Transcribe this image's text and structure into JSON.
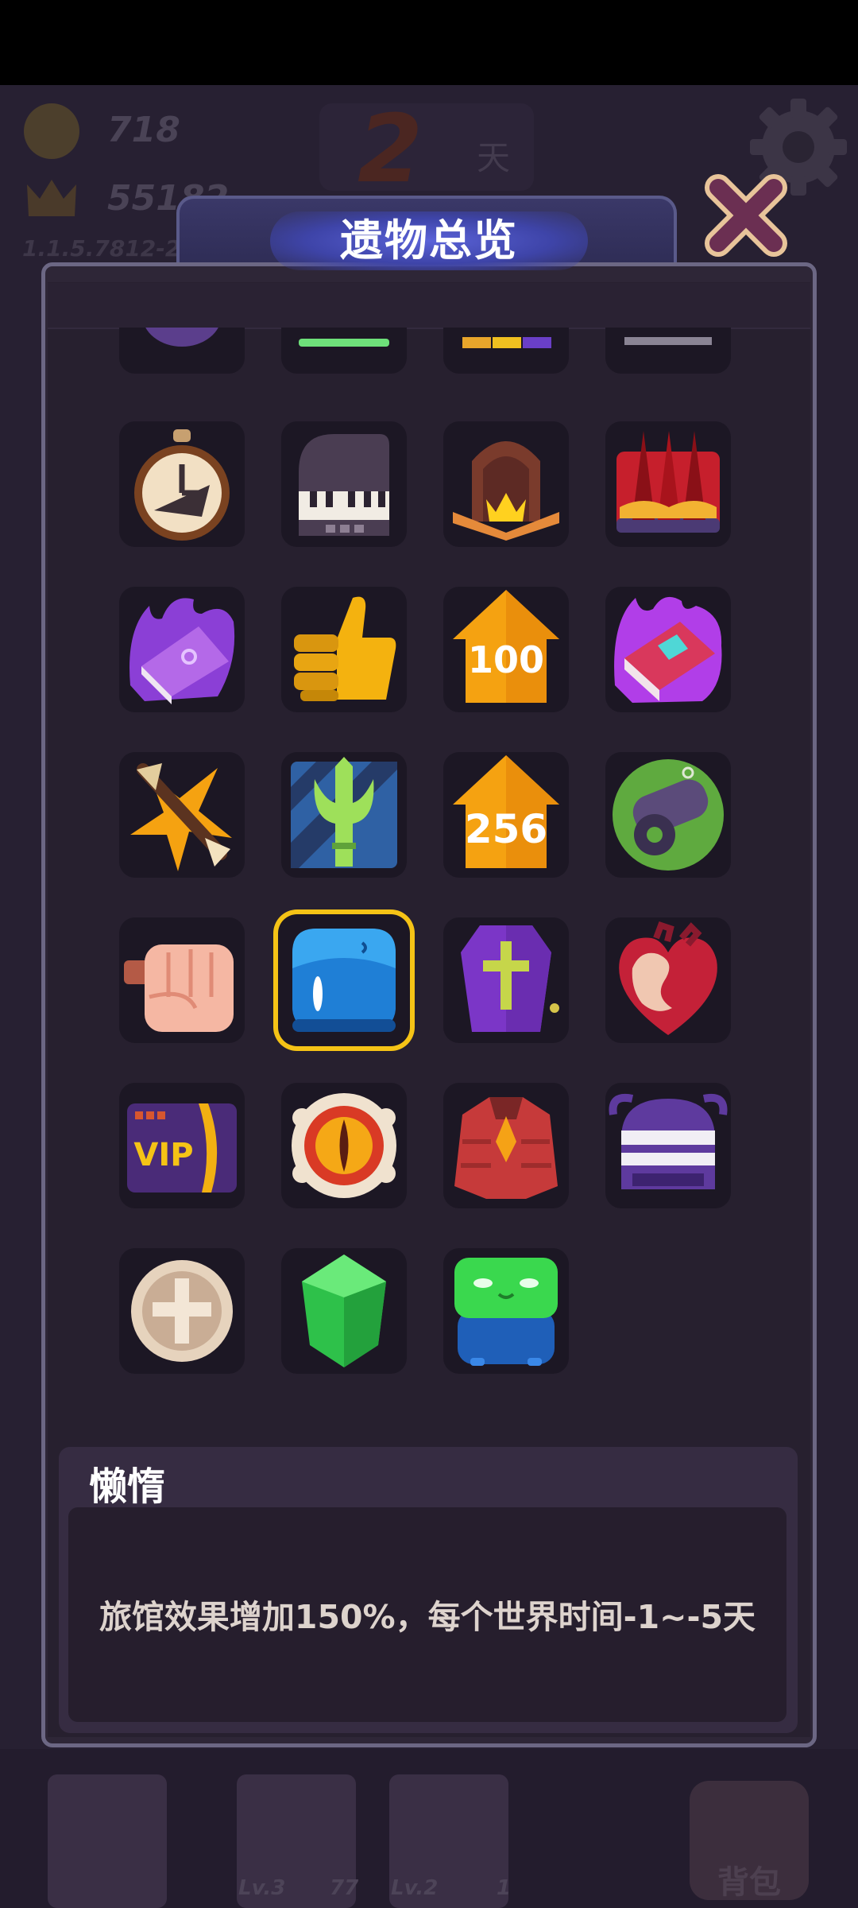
{
  "hud": {
    "gold": "718",
    "crowns": "55182",
    "version": "1.1.5.7812-2",
    "day_number": "2",
    "day_unit": "天",
    "bottom_slots": [
      {
        "level": "Lv.3",
        "count": "77"
      },
      {
        "level": "Lv.2",
        "count": "1"
      }
    ],
    "bag_label": "背包"
  },
  "modal": {
    "title": "遗物总览",
    "close_icon": "close-x-icon"
  },
  "relics": [
    {
      "name": "pocket-watch-relic-icon"
    },
    {
      "name": "piano-relic-icon"
    },
    {
      "name": "campfire-relic-icon"
    },
    {
      "name": "spike-trap-relic-icon"
    },
    {
      "name": "cursed-book-relic-icon"
    },
    {
      "name": "thumbs-up-relic-icon"
    },
    {
      "name": "house-100-relic-icon"
    },
    {
      "name": "magic-tome-relic-icon"
    },
    {
      "name": "crossed-arrows-relic-icon"
    },
    {
      "name": "trident-relic-icon"
    },
    {
      "name": "house-256-relic-icon"
    },
    {
      "name": "cannon-relic-icon"
    },
    {
      "name": "fist-relic-icon"
    },
    {
      "name": "blue-slime-relic-icon"
    },
    {
      "name": "coffin-relic-icon"
    },
    {
      "name": "heart-relic-icon"
    },
    {
      "name": "vip-card-relic-icon"
    },
    {
      "name": "eye-shield-relic-icon"
    },
    {
      "name": "red-armor-relic-icon"
    },
    {
      "name": "knight-helmet-relic-icon"
    },
    {
      "name": "holy-coin-relic-icon"
    },
    {
      "name": "green-gem-relic-icon"
    },
    {
      "name": "green-frog-relic-icon"
    }
  ],
  "selected_relic": {
    "name": "懒惰",
    "description": "旅馆效果增加150%，每个世界时间-1~-5天"
  }
}
